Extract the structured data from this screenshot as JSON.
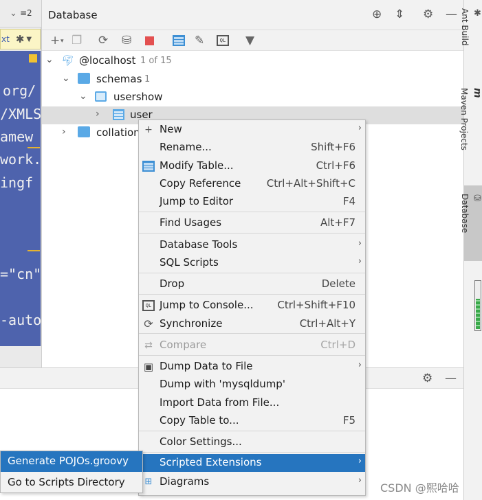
{
  "left_editor": {
    "tab_suffix": "≡2",
    "chip_text": "xt",
    "code_lines": [
      "org/",
      "/XMLS",
      "amew",
      "work.",
      "ingf",
      "=\"cn\"",
      "-auto"
    ]
  },
  "database_panel": {
    "title": "Database",
    "tree": [
      {
        "label": "@localhost",
        "count": "1 of 15"
      },
      {
        "label": "schemas",
        "count": "1"
      },
      {
        "label": "usershow",
        "count": ""
      },
      {
        "label": "user",
        "count": ""
      },
      {
        "label": "collation",
        "count": ""
      }
    ]
  },
  "sidebar": {
    "ant_build": "Ant Build",
    "maven": "Maven Projects",
    "database": "Database"
  },
  "context_menu": {
    "items": [
      {
        "label": "New",
        "shortcut": "",
        "icon": "plus-icon"
      },
      {
        "label": "Rename...",
        "shortcut": "Shift+F6",
        "icon": ""
      },
      {
        "label": "Modify Table...",
        "shortcut": "Ctrl+F6",
        "icon": "table-icon"
      },
      {
        "label": "Copy Reference",
        "shortcut": "Ctrl+Alt+Shift+C",
        "icon": ""
      },
      {
        "label": "Jump to Editor",
        "shortcut": "F4",
        "icon": ""
      },
      {
        "label": "Find Usages",
        "shortcut": "Alt+F7",
        "icon": ""
      },
      {
        "label": "Database Tools",
        "shortcut": "",
        "icon": ""
      },
      {
        "label": "SQL Scripts",
        "shortcut": "",
        "icon": ""
      },
      {
        "label": "Drop",
        "shortcut": "Delete",
        "icon": ""
      },
      {
        "label": "Jump to Console...",
        "shortcut": "Ctrl+Shift+F10",
        "icon": "sql-console-icon"
      },
      {
        "label": "Synchronize",
        "shortcut": "Ctrl+Alt+Y",
        "icon": "sync-icon"
      },
      {
        "label": "Compare",
        "shortcut": "Ctrl+D",
        "icon": "compare-icon"
      },
      {
        "label": "Dump Data to File",
        "shortcut": "",
        "icon": "save-icon"
      },
      {
        "label": "Dump with 'mysqldump'",
        "shortcut": "",
        "icon": ""
      },
      {
        "label": "Import Data from File...",
        "shortcut": "",
        "icon": ""
      },
      {
        "label": "Copy Table to...",
        "shortcut": "F5",
        "icon": ""
      },
      {
        "label": "Color Settings...",
        "shortcut": "",
        "icon": ""
      },
      {
        "label": "Scripted Extensions",
        "shortcut": "",
        "icon": ""
      },
      {
        "label": "Diagrams",
        "shortcut": "",
        "icon": "diagram-icon"
      }
    ]
  },
  "submenu": {
    "items": [
      {
        "label": "Generate POJOs.groovy"
      },
      {
        "label": "Go to Scripts Directory"
      }
    ]
  },
  "watermark": "CSDN @熙哈哈",
  "colors": {
    "highlight": "#2675bf",
    "editor_bg": "#4e63ad",
    "folder": "#5aa9e6"
  }
}
